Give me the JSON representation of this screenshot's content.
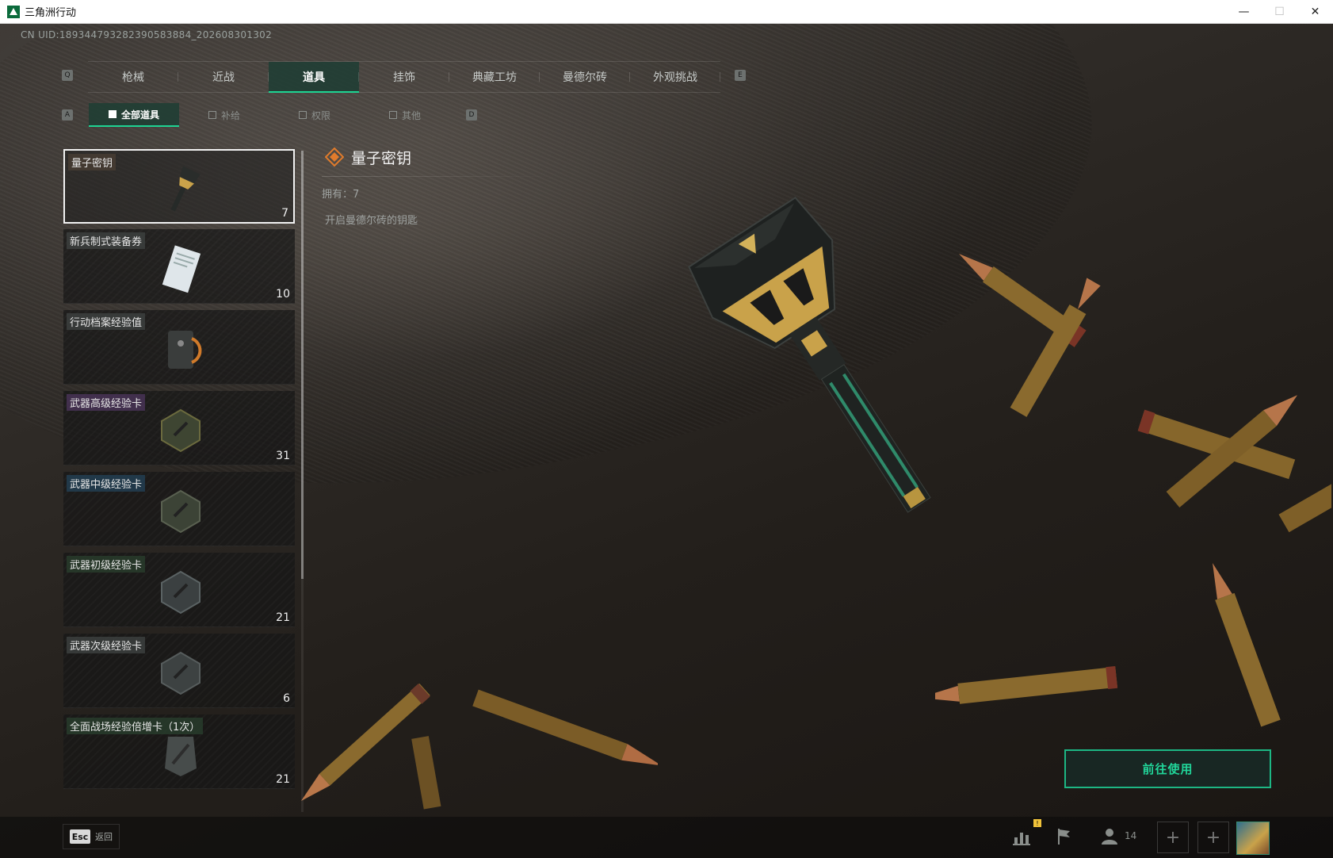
{
  "window": {
    "title": "三角洲行动",
    "minimize": "—",
    "maximize": "☐",
    "close": "✕"
  },
  "uid_text": "CN UID:189344793282390583884_202608301302",
  "tabs": {
    "prev_key": "Q",
    "next_key": "E",
    "items": [
      {
        "label": "枪械",
        "active": false
      },
      {
        "label": "近战",
        "active": false
      },
      {
        "label": "道具",
        "active": true
      },
      {
        "label": "挂饰",
        "active": false
      },
      {
        "label": "典藏工坊",
        "active": false
      },
      {
        "label": "曼德尔砖",
        "active": false
      },
      {
        "label": "外观挑战",
        "active": false
      }
    ]
  },
  "subtabs": {
    "prev_key": "A",
    "next_key": "D",
    "items": [
      {
        "label": "全部道具",
        "active": true
      },
      {
        "label": "补给",
        "active": false
      },
      {
        "label": "权限",
        "active": false
      },
      {
        "label": "其他",
        "active": false
      }
    ]
  },
  "items": [
    {
      "name": "量子密钥",
      "count": "7",
      "selected": true,
      "tier": "key"
    },
    {
      "name": "新兵制式装备券",
      "count": "10",
      "selected": false,
      "tier": "none"
    },
    {
      "name": "行动档案经验值",
      "count": "",
      "selected": false,
      "tier": "none"
    },
    {
      "name": "武器高级经验卡",
      "count": "31",
      "selected": false,
      "tier": "rare"
    },
    {
      "name": "武器中级经验卡",
      "count": "",
      "selected": false,
      "tier": "uncommon"
    },
    {
      "name": "武器初级经验卡",
      "count": "21",
      "selected": false,
      "tier": "common"
    },
    {
      "name": "武器次级经验卡",
      "count": "6",
      "selected": false,
      "tier": "none"
    },
    {
      "name": "全面战场经验倍增卡（1次）",
      "count": "21",
      "selected": false,
      "tier": "common"
    }
  ],
  "detail": {
    "title": "量子密钥",
    "owned": "拥有：7",
    "description": "开启曼德尔砖的钥匙"
  },
  "use_button": "前往使用",
  "bottom": {
    "esc_key": "Esc",
    "esc_label": "返回",
    "friend_count": "14",
    "notification": "!",
    "plus": "+"
  },
  "colors": {
    "accent": "#1ed493",
    "button_text": "#21d69a",
    "selected_border": "#f2f2f2",
    "key_gold": "#c9a24a"
  },
  "icons": [
    "stats-icon",
    "flag-icon",
    "friends-icon",
    "diamond-icon",
    "avatar"
  ]
}
